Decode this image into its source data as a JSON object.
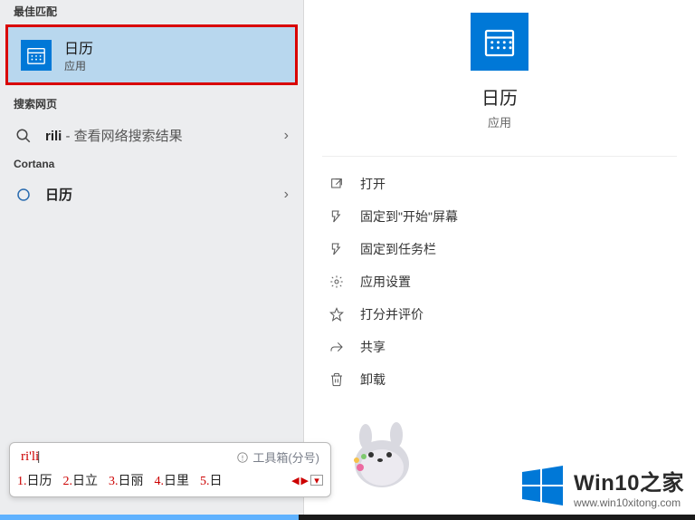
{
  "left": {
    "section_best": "最佳匹配",
    "best_match": {
      "title": "日历",
      "subtitle": "应用"
    },
    "section_web": "搜索网页",
    "web_query_bold": "rili",
    "web_suffix": " - 查看网络搜索结果",
    "section_cortana": "Cortana",
    "cortana_item": "日历"
  },
  "right": {
    "app_name": "日历",
    "app_type": "应用",
    "actions": {
      "open": "打开",
      "pin_start": "固定到\"开始\"屏幕",
      "pin_taskbar": "固定到任务栏",
      "app_settings": "应用设置",
      "rate": "打分并评价",
      "share": "共享",
      "uninstall": "卸载"
    }
  },
  "ime": {
    "input": "ri'li",
    "toolbox": "工具箱(分号)",
    "candidates": [
      "日历",
      "日立",
      "日丽",
      "日里",
      "日"
    ],
    "labels": [
      "1.",
      "2.",
      "3.",
      "4.",
      "5."
    ]
  },
  "watermark": {
    "title": "Win10之家",
    "url": "www.win10xitong.com"
  }
}
